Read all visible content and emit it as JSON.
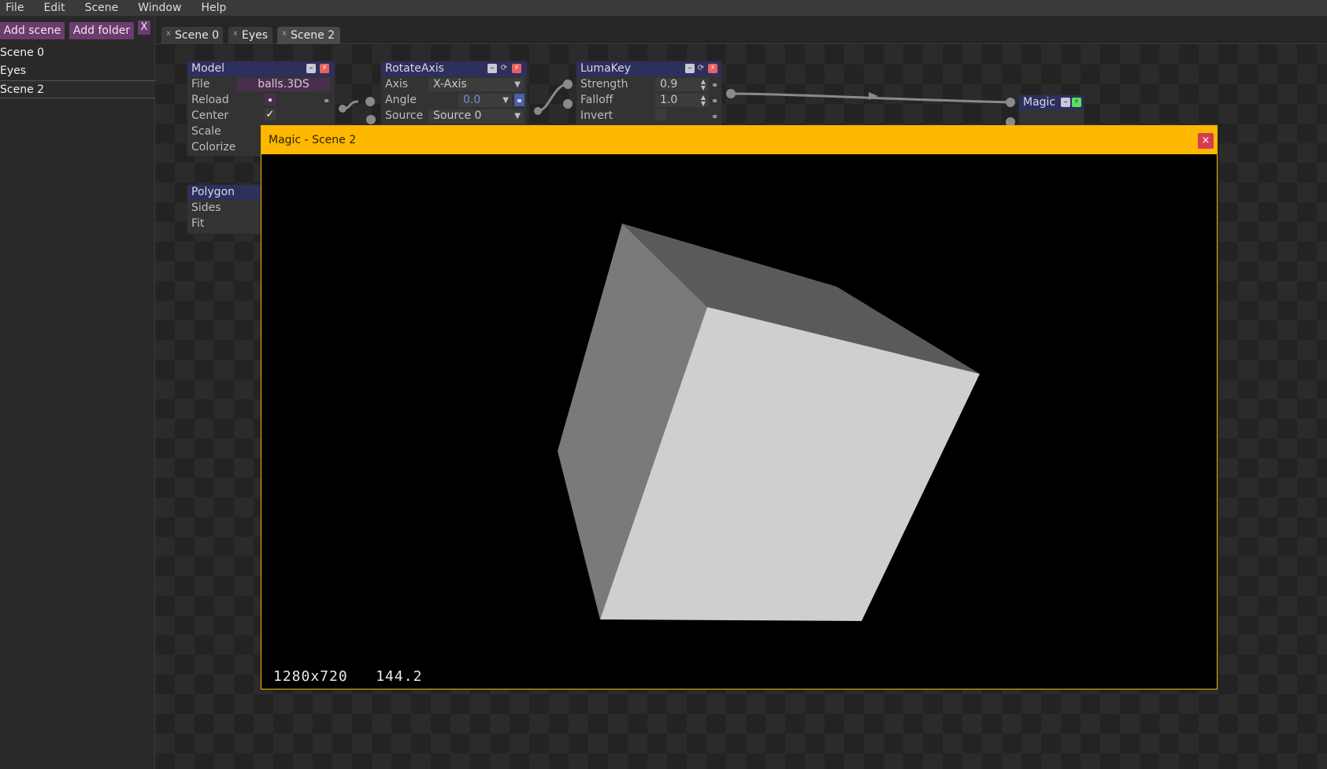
{
  "menu": [
    "File",
    "Edit",
    "Scene",
    "Window",
    "Help"
  ],
  "sidebar": {
    "add_scene": "Add scene",
    "add_folder": "Add folder",
    "close": "X",
    "scenes": [
      "Scene 0",
      "Eyes",
      "Scene 2"
    ],
    "selected": "Scene 2"
  },
  "tabs": [
    {
      "close": "x",
      "label": "Scene 0"
    },
    {
      "close": "x",
      "label": "Eyes"
    },
    {
      "close": "x",
      "label": "Scene 2"
    }
  ],
  "active_tab": "Scene 2",
  "nodes": {
    "model": {
      "title": "Model",
      "rows": {
        "file": "File",
        "reload": "Reload",
        "center": "Center",
        "scale": "Scale",
        "colorize": "Colorize"
      },
      "file_value": "balls.3DS",
      "center_checked": "✓"
    },
    "polygon": {
      "title": "Polygon",
      "rows": {
        "sides": "Sides",
        "fit": "Fit"
      }
    },
    "rotateaxis": {
      "title": "RotateAxis",
      "rows": {
        "axis": "Axis",
        "angle": "Angle",
        "source": "Source"
      },
      "axis_value": "X-Axis",
      "angle_value": "0.0",
      "source_value": "Source 0"
    },
    "lumakey": {
      "title": "LumaKey",
      "rows": {
        "strength": "Strength",
        "falloff": "Falloff",
        "invert": "Invert"
      },
      "strength_value": "0.9",
      "falloff_value": "1.0"
    },
    "magic": {
      "title": "Magic"
    }
  },
  "preview": {
    "title": "Magic - Scene 2",
    "close": "×",
    "resolution": "1280x720",
    "fps": "144.2"
  },
  "colors": {
    "accent_window": "#ffb800",
    "node_header": "#2d2f5c",
    "button_purple": "#6b3c6e",
    "close_red": "#d43c50"
  }
}
